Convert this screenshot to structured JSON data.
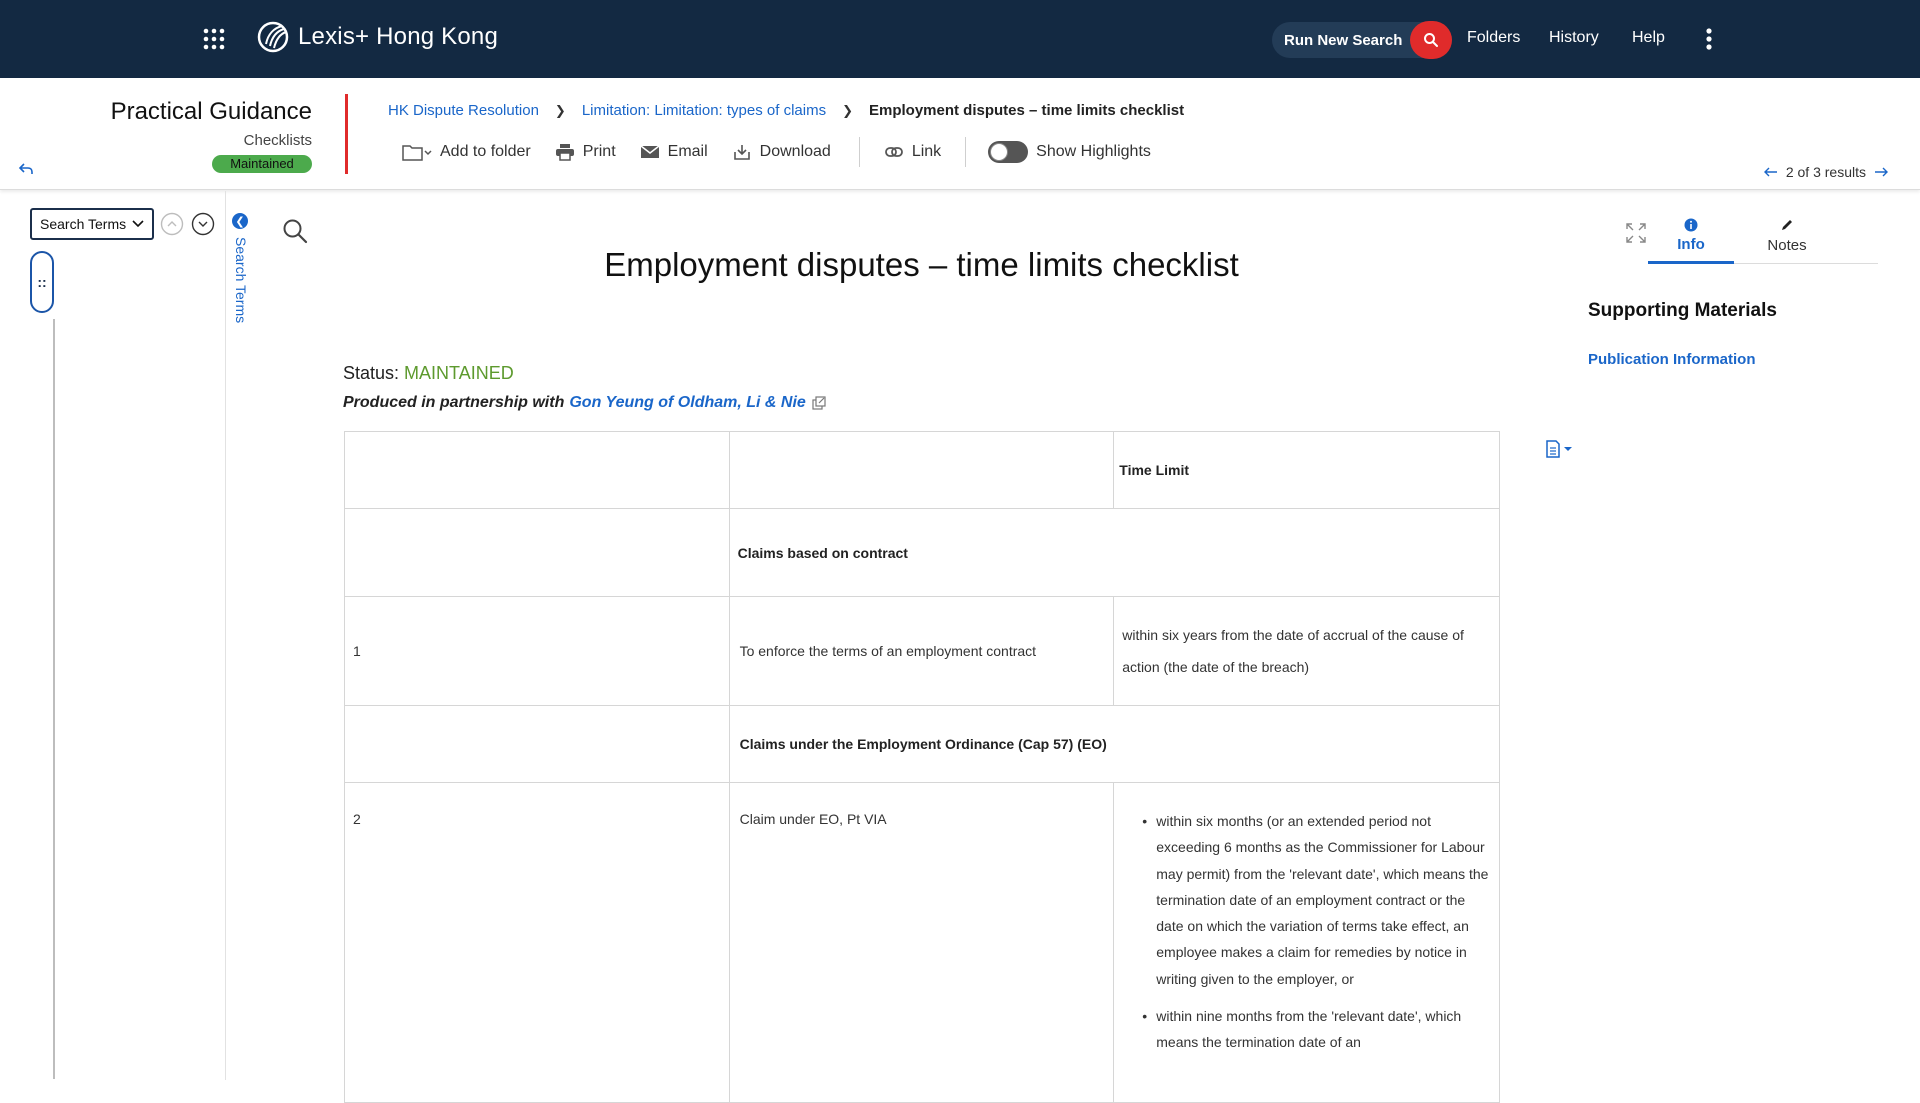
{
  "app": {
    "brand": "Lexis+",
    "brand_suffix": "Hong Kong"
  },
  "topnav": {
    "run_search_label": "Run New Search",
    "links": [
      "Folders",
      "History",
      "Help"
    ]
  },
  "module": {
    "title": "Practical Guidance",
    "subtitle": "Checklists",
    "badge": "Maintained"
  },
  "breadcrumb": {
    "items": [
      "HK Dispute Resolution",
      "Limitation: Limitation: types of claims"
    ],
    "current": "Employment disputes – time limits checklist"
  },
  "toolbar": {
    "add_to_folder": "Add to folder",
    "print": "Print",
    "email": "Email",
    "download": "Download",
    "link": "Link",
    "show_highlights": "Show Highlights"
  },
  "results_nav": {
    "text": "2 of 3 results"
  },
  "left_panel": {
    "terms_select": "Search Terms",
    "tab_label": "Search Terms"
  },
  "document": {
    "title": "Employment disputes – time limits checklist",
    "status_label": "Status:",
    "status_value": "MAINTAINED",
    "produced_prefix": "Produced in partnership with",
    "produced_link": "Gon Yeung of Oldham, Li & Nie",
    "table": {
      "header_time_limit": "Time Limit",
      "section_contract": "Claims based on contract",
      "row1_num": "1",
      "row1_claim": "To enforce the terms of an employment contract",
      "row1_limit": "within six years from the date of accrual of the cause of action (the date of the breach)",
      "section_eo": "Claims under the Employment Ordinance (Cap 57) (EO)",
      "row2_num": "2",
      "row2_claim": "Claim under EO, Pt VIA",
      "row2_bullets": [
        "within six months (or an extended period not exceeding 6 months as the Commissioner for Labour may permit) from the 'relevant date', which means the termination date of an employment contract or the date on which the variation of terms take effect, an employee makes a claim for remedies by notice in writing given to the employer, or",
        "within nine months from the 'relevant date', which means the termination date of an"
      ]
    }
  },
  "right_panel": {
    "tab_info": "Info",
    "tab_notes": "Notes",
    "supporting_title": "Supporting Materials",
    "publication_link": "Publication Information"
  },
  "colors": {
    "topbar": "#132942",
    "accent_red": "#e02b2b",
    "link_blue": "#1a66c9",
    "status_green": "#5d9a2e",
    "badge_green": "#4caa4c"
  }
}
